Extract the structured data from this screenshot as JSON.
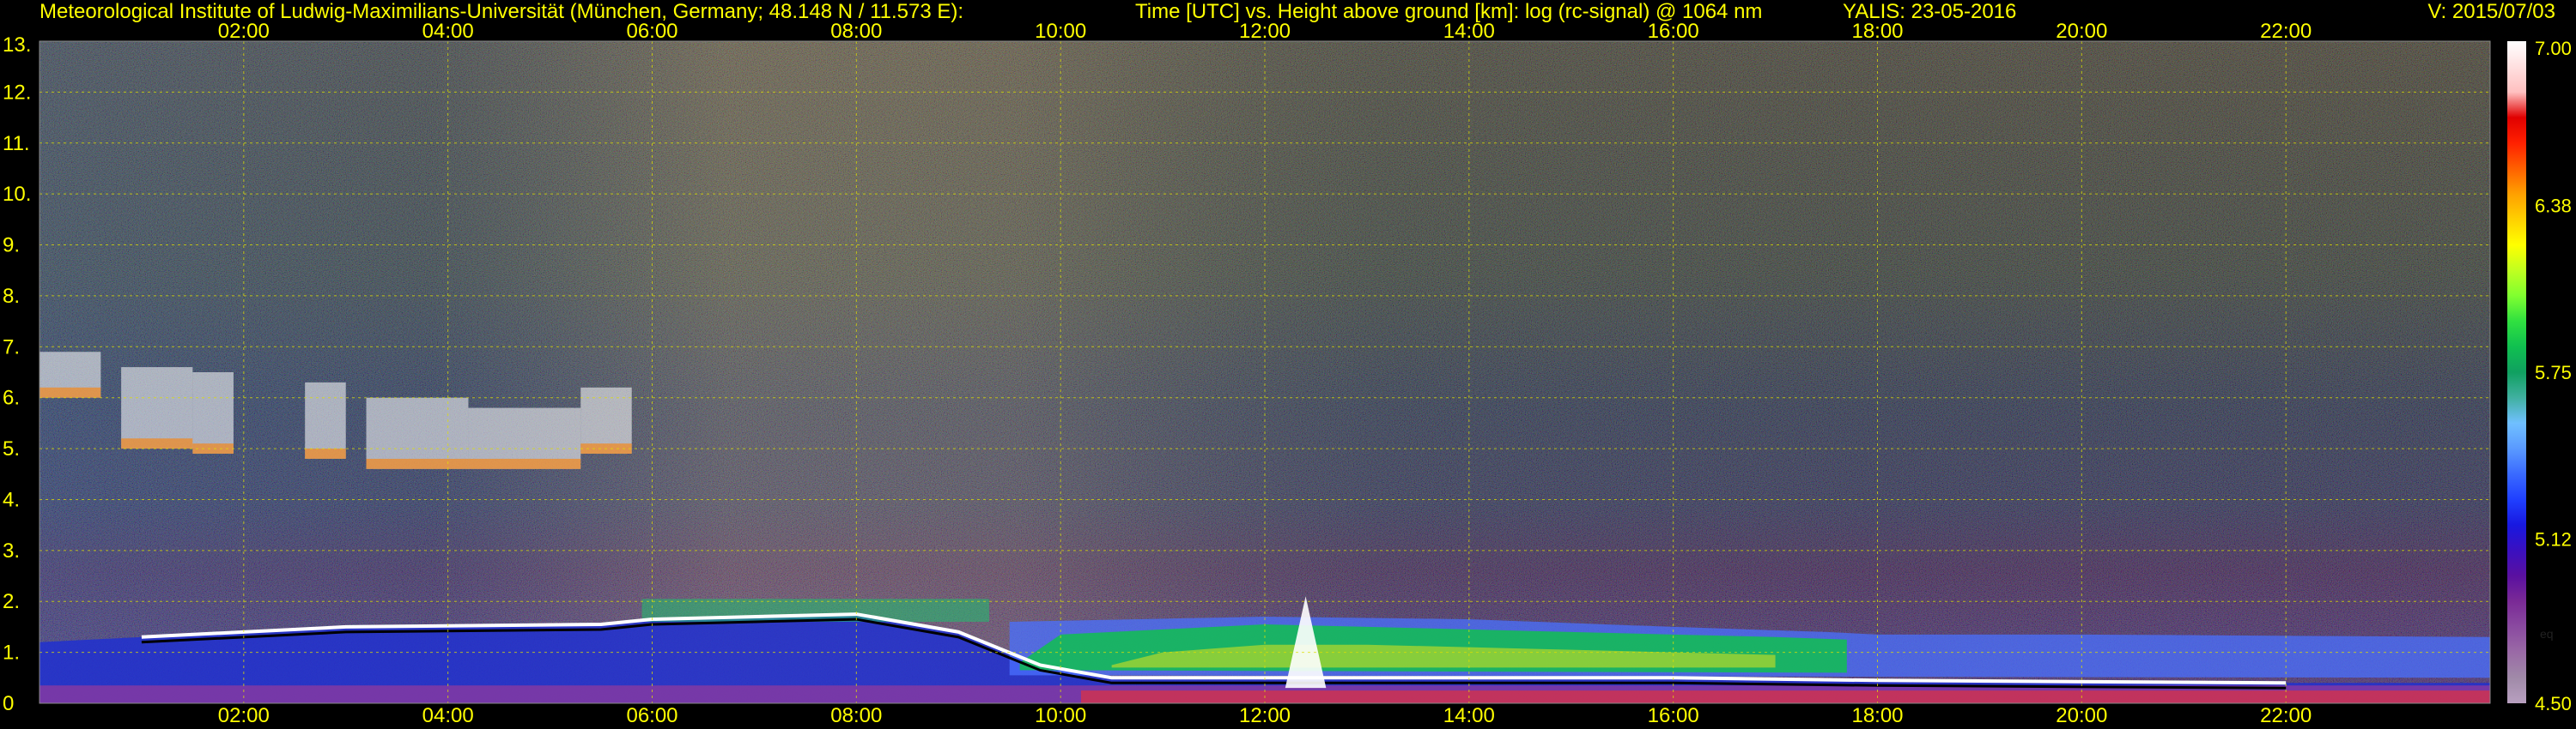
{
  "header": {
    "institute": "Meteorological Institute of Ludwig-Maximilians-Universität (München, Germany; 48.148 N / 11.573 E):",
    "axes_desc": "Time [UTC] vs. Height above ground [km]: log (rc-signal) @ 1064 nm",
    "site_date": "YALIS: 23-05-2016",
    "version": "V: 2015/07/03"
  },
  "chart_data": {
    "type": "heatmap",
    "x_ticks": [
      "02:00",
      "04:00",
      "06:00",
      "08:00",
      "10:00",
      "12:00",
      "14:00",
      "16:00",
      "18:00",
      "20:00",
      "22:00"
    ],
    "y_ticks": [
      "0",
      "1.",
      "2.",
      "3.",
      "4.",
      "5.",
      "6.",
      "7.",
      "8.",
      "9.",
      "10.",
      "11.",
      "12.",
      "13."
    ],
    "xlim_hours": [
      0,
      24
    ],
    "ylim_km": [
      0,
      13
    ],
    "grid": true,
    "colorbar": {
      "min": 4.5,
      "max": 7.0,
      "labels": [
        {
          "value": 7.0,
          "text": "7.00"
        },
        {
          "value": 6.38,
          "text": "6.38"
        },
        {
          "value": 5.75,
          "text": "5.75"
        },
        {
          "value": 5.12,
          "text": "5.12"
        },
        {
          "value": 4.5,
          "text": "4.50"
        }
      ],
      "unit_label": "eq"
    },
    "colormap": [
      "#b8a0c0",
      "#a08aa8",
      "#9a6aa6",
      "#8a4aa0",
      "#7a2a96",
      "#5a10a0",
      "#3a10c0",
      "#1818e0",
      "#2040ff",
      "#3a6aff",
      "#5a9aff",
      "#70c0ff",
      "#40b0a0",
      "#10a060",
      "#10c050",
      "#30e040",
      "#80ff30",
      "#c0ff20",
      "#ffff00",
      "#ffd000",
      "#ffa000",
      "#ff6000",
      "#ff2000",
      "#e00000",
      "#ffc0c0",
      "#ffe0e0",
      "#ffffff"
    ],
    "features": {
      "boundary_layer_top_km": [
        {
          "t": 1.0,
          "z": 1.3
        },
        {
          "t": 3.0,
          "z": 1.5
        },
        {
          "t": 5.5,
          "z": 1.55
        },
        {
          "t": 6.0,
          "z": 1.65
        },
        {
          "t": 8.0,
          "z": 1.75
        },
        {
          "t": 9.0,
          "z": 1.4
        },
        {
          "t": 9.8,
          "z": 0.75
        },
        {
          "t": 10.5,
          "z": 0.5
        },
        {
          "t": 12.0,
          "z": 0.5
        },
        {
          "t": 14.0,
          "z": 0.5
        },
        {
          "t": 16.0,
          "z": 0.5
        },
        {
          "t": 18.0,
          "z": 0.45
        },
        {
          "t": 22.0,
          "z": 0.4
        }
      ],
      "residual_layer_top_km": [
        {
          "t": 9.5,
          "z": 1.6
        },
        {
          "t": 12.0,
          "z": 1.7
        },
        {
          "t": 14.0,
          "z": 1.65
        },
        {
          "t": 16.0,
          "z": 1.5
        },
        {
          "t": 17.5,
          "z": 1.4
        },
        {
          "t": 18.0,
          "z": 1.35
        },
        {
          "t": 20.0,
          "z": 1.35
        },
        {
          "t": 24.0,
          "z": 1.3
        }
      ],
      "cloud_layer_km": {
        "t_start": 0.0,
        "t_end": 5.8,
        "z_base": 4.6,
        "z_top": 6.9
      }
    }
  }
}
